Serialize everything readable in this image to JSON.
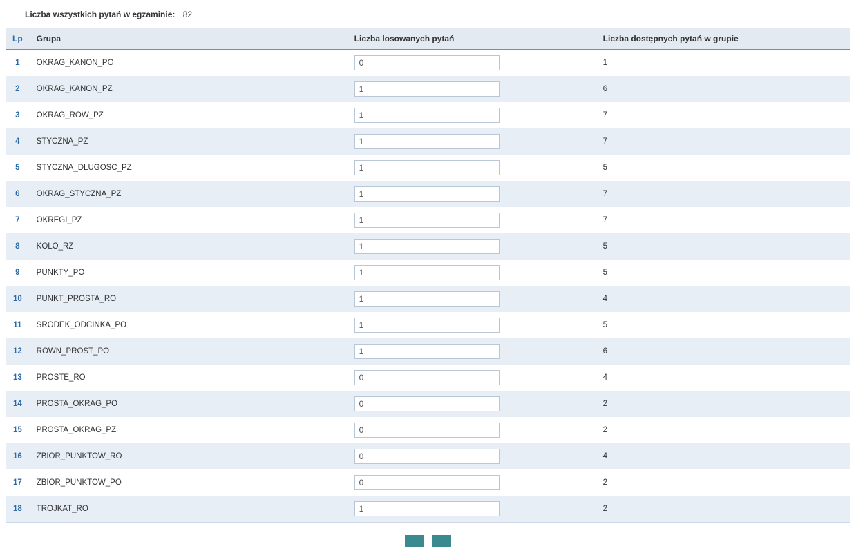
{
  "summary": {
    "label": "Liczba wszystkich pytań w egzaminie:",
    "value": "82"
  },
  "headers": {
    "lp": "Lp",
    "grupa": "Grupa",
    "losowanych": "Liczba losowanych pytań",
    "dostepnych": "Liczba dostępnych pytań w grupie"
  },
  "rows": [
    {
      "lp": "1",
      "grupa": "OKRAG_KANON_PO",
      "losow": "0",
      "dost": "1"
    },
    {
      "lp": "2",
      "grupa": "OKRAG_KANON_PZ",
      "losow": "1",
      "dost": "6"
    },
    {
      "lp": "3",
      "grupa": "OKRAG_ROW_PZ",
      "losow": "1",
      "dost": "7"
    },
    {
      "lp": "4",
      "grupa": "STYCZNA_PZ",
      "losow": "1",
      "dost": "7"
    },
    {
      "lp": "5",
      "grupa": "STYCZNA_DLUGOSC_PZ",
      "losow": "1",
      "dost": "5"
    },
    {
      "lp": "6",
      "grupa": "OKRAG_STYCZNA_PZ",
      "losow": "1",
      "dost": "7"
    },
    {
      "lp": "7",
      "grupa": "OKREGI_PZ",
      "losow": "1",
      "dost": "7"
    },
    {
      "lp": "8",
      "grupa": "KOLO_RZ",
      "losow": "1",
      "dost": "5"
    },
    {
      "lp": "9",
      "grupa": "PUNKTY_PO",
      "losow": "1",
      "dost": "5"
    },
    {
      "lp": "10",
      "grupa": "PUNKT_PROSTA_RO",
      "losow": "1",
      "dost": "4"
    },
    {
      "lp": "11",
      "grupa": "SRODEK_ODCINKA_PO",
      "losow": "1",
      "dost": "5"
    },
    {
      "lp": "12",
      "grupa": "ROWN_PROST_PO",
      "losow": "1",
      "dost": "6"
    },
    {
      "lp": "13",
      "grupa": "PROSTE_RO",
      "losow": "0",
      "dost": "4"
    },
    {
      "lp": "14",
      "grupa": "PROSTA_OKRAG_PO",
      "losow": "0",
      "dost": "2"
    },
    {
      "lp": "15",
      "grupa": "PROSTA_OKRAG_PZ",
      "losow": "0",
      "dost": "2"
    },
    {
      "lp": "16",
      "grupa": "ZBIOR_PUNKTOW_RO",
      "losow": "0",
      "dost": "4"
    },
    {
      "lp": "17",
      "grupa": "ZBIOR_PUNKTOW_PO",
      "losow": "0",
      "dost": "2"
    },
    {
      "lp": "18",
      "grupa": "TROJKAT_RO",
      "losow": "1",
      "dost": "2"
    }
  ],
  "buttons": {
    "left": "",
    "right": ""
  }
}
